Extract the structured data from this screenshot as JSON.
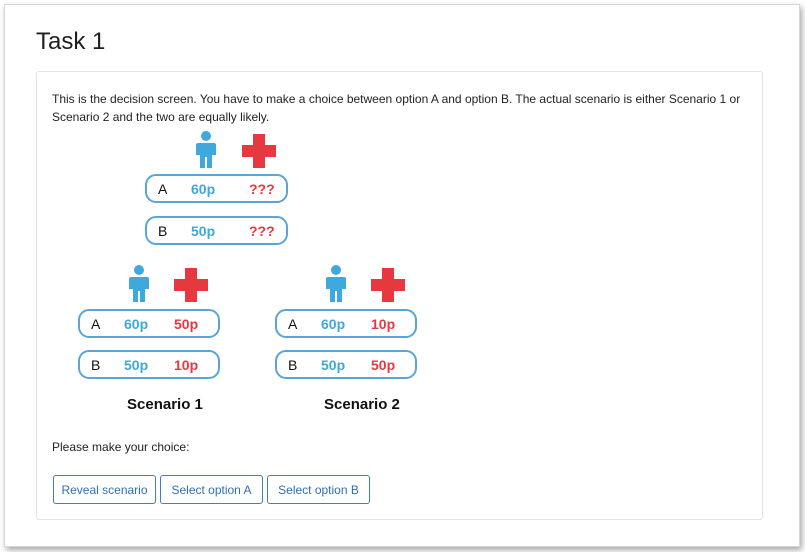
{
  "title": "Task 1",
  "intro": "This is the decision screen. You have to make a choice between option A and option B. The actual scenario is either Scenario 1 or Scenario 2 and the two are equally likely.",
  "icons": {
    "person": "person-icon",
    "cross": "red-cross-icon"
  },
  "colors": {
    "blue": "#3fa8dc",
    "red": "#e6393f",
    "border": "#5aa5d6",
    "button": "#3b7fc4"
  },
  "decision": {
    "rows": [
      {
        "letter": "A",
        "blue": "60p",
        "red": "???"
      },
      {
        "letter": "B",
        "blue": "50p",
        "red": "???"
      }
    ]
  },
  "scenario1": {
    "label": "Scenario 1",
    "rows": [
      {
        "letter": "A",
        "blue": "60p",
        "red": "50p"
      },
      {
        "letter": "B",
        "blue": "50p",
        "red": "10p"
      }
    ]
  },
  "scenario2": {
    "label": "Scenario 2",
    "rows": [
      {
        "letter": "A",
        "blue": "60p",
        "red": "10p"
      },
      {
        "letter": "B",
        "blue": "50p",
        "red": "50p"
      }
    ]
  },
  "prompt": "Please make your choice:",
  "buttons": {
    "reveal": "Reveal scenario",
    "select_a": "Select option A",
    "select_b": "Select option B"
  }
}
